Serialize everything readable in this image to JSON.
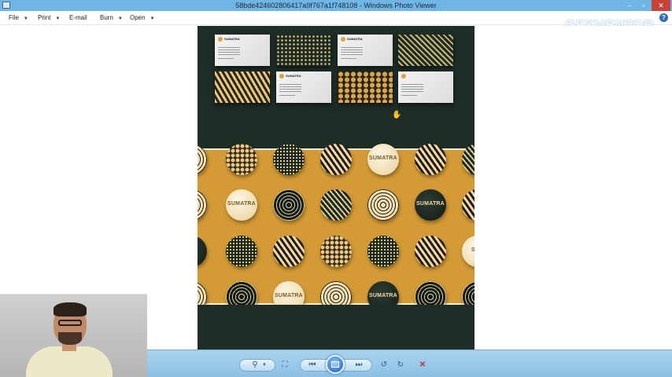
{
  "window": {
    "title": "58bde424602806417a9f767a1f748108 - Windows Photo Viewer",
    "controls": {
      "minimize": "–",
      "maximize": "▫",
      "close": "✕"
    }
  },
  "menu": {
    "file": "File",
    "print": "Print",
    "email": "E-mail",
    "burn": "Burn",
    "open": "Open",
    "help": "?"
  },
  "watermark": "GFXMENTOR",
  "photo": {
    "cards": [
      {
        "style": "white",
        "brand": "SUMATRA"
      },
      {
        "style": "dots"
      },
      {
        "style": "white",
        "brand": "SUMATRA"
      },
      {
        "style": "stripes"
      },
      {
        "style": "zebra"
      },
      {
        "style": "white",
        "brand": "SUMATRA"
      },
      {
        "style": "giraffe"
      },
      {
        "style": "white",
        "brand": ""
      }
    ],
    "button_rows": [
      [
        "sun-cream",
        "giraffe",
        "dotted",
        "zebra",
        "cream:SUMATRA",
        "zebra",
        "stripe-dark"
      ],
      [
        "sun-cream",
        "cream:SUMATRA",
        "sun-dark",
        "stripe-dark",
        "sun-cream",
        "dark:SUMATRA",
        "zebra"
      ],
      [
        "dark",
        "dotted",
        "zebra",
        "giraffe",
        "dotted",
        "zebra",
        "cream:SUM"
      ],
      [
        "sun-cream",
        "sun-dark",
        "cream:SUMATRA",
        "sun-cream",
        "dark:SUMATRA",
        "sun-dark",
        "sun-dark"
      ]
    ]
  },
  "toolbar": {
    "zoom": "⚲",
    "zoom_caret": "▾",
    "fit": "⛶",
    "previous": "⏮",
    "next": "⏭",
    "rotate_ccw": "↺",
    "rotate_cw": "↻",
    "delete": "✕"
  },
  "colors": {
    "titlebar": "#6fb5e6",
    "photo_dark_green": "#1f2d27",
    "photo_mustard": "#d39a35",
    "toolbar": "#a9d3ee",
    "delete_red": "#c62d2d"
  }
}
